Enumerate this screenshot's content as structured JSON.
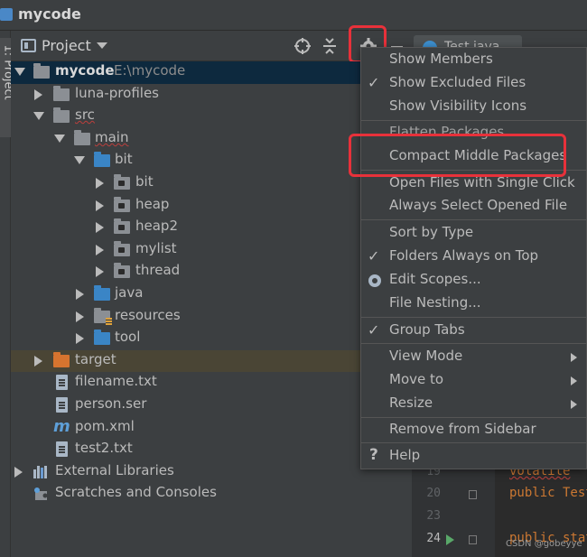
{
  "window": {
    "title": "mycode"
  },
  "side_tab": {
    "label": "1: Project"
  },
  "panel": {
    "title": "Project",
    "tools": {
      "locate_icon": "crosshair-icon",
      "collapse_icon": "collapse-all-icon",
      "gear_icon": "gear-icon",
      "minimize_icon": "minimize-icon"
    }
  },
  "editor_tab": {
    "label": "Test.java"
  },
  "tree": {
    "root": {
      "name": "mycode",
      "path": "E:\\mycode"
    },
    "items": [
      {
        "label": "luna-profiles"
      },
      {
        "label": "src"
      },
      {
        "label": "main"
      },
      {
        "label": "bit"
      },
      {
        "label": "bit"
      },
      {
        "label": "heap"
      },
      {
        "label": "heap2"
      },
      {
        "label": "mylist"
      },
      {
        "label": "thread"
      },
      {
        "label": "java"
      },
      {
        "label": "resources"
      },
      {
        "label": "tool"
      },
      {
        "label": "target"
      },
      {
        "label": "filename.txt"
      },
      {
        "label": "person.ser"
      },
      {
        "label": "pom.xml"
      },
      {
        "label": "test2.txt"
      },
      {
        "label": "External Libraries"
      },
      {
        "label": "Scratches and Consoles"
      }
    ]
  },
  "menu": {
    "items": [
      {
        "label": "Show Members"
      },
      {
        "label": "Show Excluded Files"
      },
      {
        "label": "Show Visibility Icons"
      },
      {
        "label": "Flatten Packages"
      },
      {
        "label": "Compact Middle Packages"
      },
      {
        "label": "Open Files with Single Click"
      },
      {
        "label": "Always Select Opened File"
      },
      {
        "label": "Sort by Type"
      },
      {
        "label": "Folders Always on Top"
      },
      {
        "label": "Edit Scopes..."
      },
      {
        "label": "File Nesting..."
      },
      {
        "label": "Group Tabs"
      },
      {
        "label": "View Mode"
      },
      {
        "label": "Move to"
      },
      {
        "label": "Resize"
      },
      {
        "label": "Remove from Sidebar"
      },
      {
        "label": "Help"
      }
    ]
  },
  "editor": {
    "lines": [
      {
        "num": "19",
        "code": "volatile"
      },
      {
        "num": "20",
        "code": "public Test"
      },
      {
        "num": "23",
        "code": ""
      },
      {
        "num": "24",
        "code": "public stat"
      }
    ]
  },
  "watermark": "CSDN @gobeyye"
}
